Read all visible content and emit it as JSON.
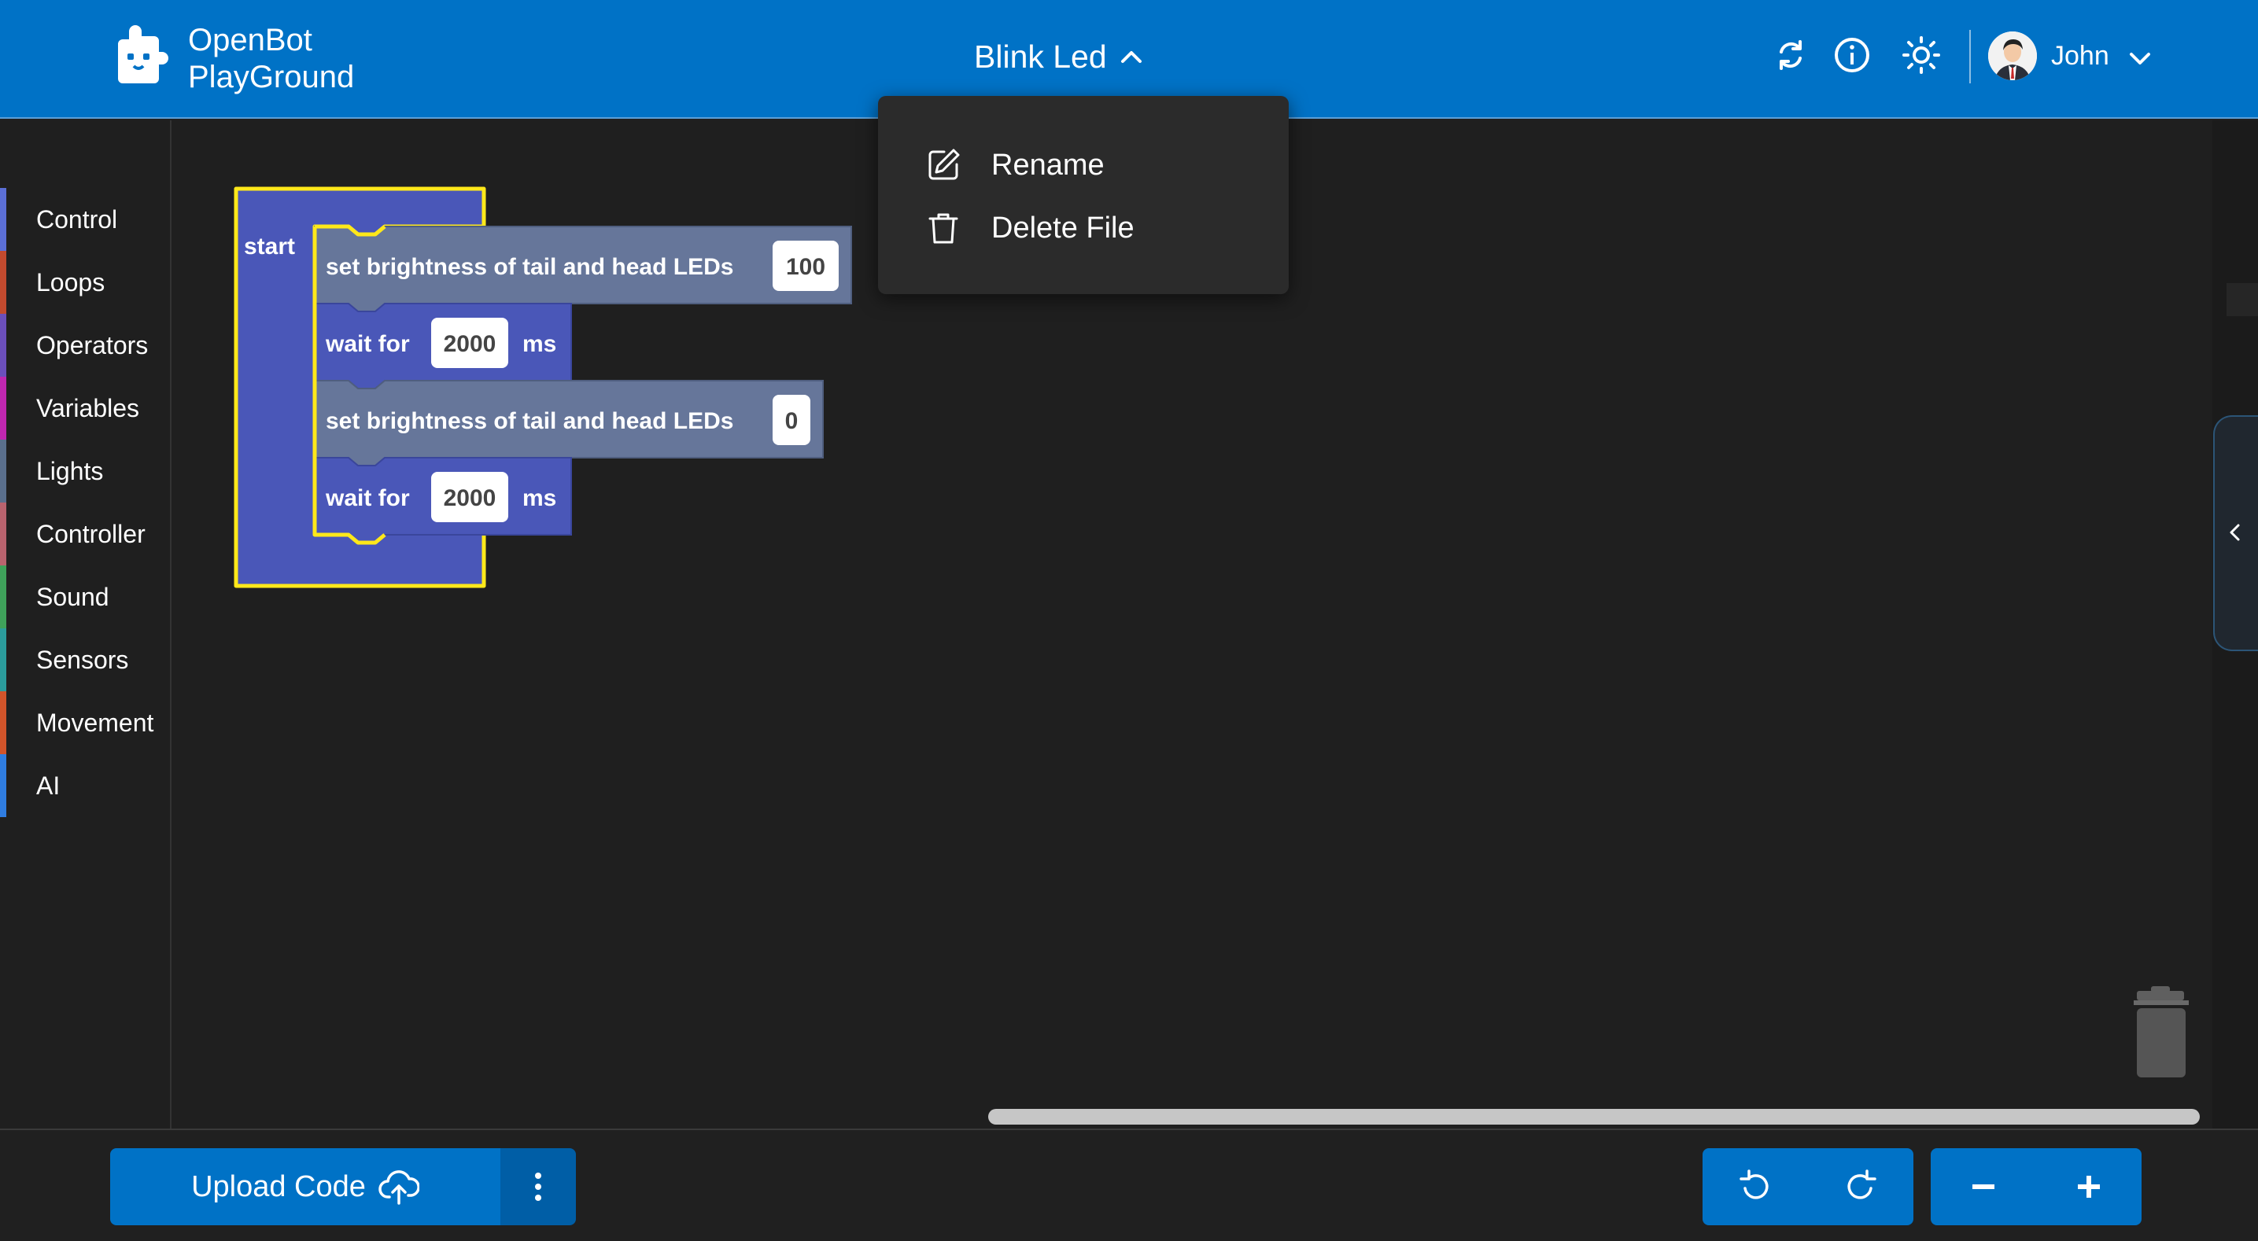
{
  "header": {
    "brand_line1": "OpenBot",
    "brand_line2": "PlayGround",
    "file_title": "Blink Led",
    "icons": [
      "logo-icon",
      "sync-icon",
      "info-icon",
      "theme-toggle-icon",
      "chevron-up-icon",
      "chevron-down-icon"
    ],
    "user_name": "John",
    "color": "#0072c6"
  },
  "dropdown": {
    "items": [
      {
        "label": "Rename",
        "icon": "edit-icon"
      },
      {
        "label": "Delete File",
        "icon": "trash-icon"
      }
    ]
  },
  "sidebar": {
    "categories": [
      {
        "label": "Control",
        "color": "#5b6fd6"
      },
      {
        "label": "Loops",
        "color": "#c24a2e"
      },
      {
        "label": "Operators",
        "color": "#6b4fbb"
      },
      {
        "label": "Variables",
        "color": "#c027b0"
      },
      {
        "label": "Lights",
        "color": "#5a6f8c"
      },
      {
        "label": "Controller",
        "color": "#b9636e"
      },
      {
        "label": "Sound",
        "color": "#3fa15a"
      },
      {
        "label": "Sensors",
        "color": "#2b9c9c"
      },
      {
        "label": "Movement",
        "color": "#d1542a"
      },
      {
        "label": "AI",
        "color": "#2f7de1"
      }
    ]
  },
  "workspace": {
    "start_label": "start",
    "blocks": [
      {
        "type": "brightness",
        "label": "set brightness of tail and head LEDs",
        "value": "100"
      },
      {
        "type": "wait",
        "label": "wait for",
        "value": "2000",
        "unit": "ms"
      },
      {
        "type": "brightness",
        "label": "set brightness of tail and head LEDs",
        "value": "0"
      },
      {
        "type": "wait",
        "label": "wait for",
        "value": "2000",
        "unit": "ms"
      }
    ]
  },
  "bottom": {
    "upload_label": "Upload Code",
    "icons": [
      "cloud-upload-icon",
      "more-vertical-icon",
      "undo-icon",
      "redo-icon",
      "zoom-out-icon",
      "zoom-in-icon"
    ]
  }
}
